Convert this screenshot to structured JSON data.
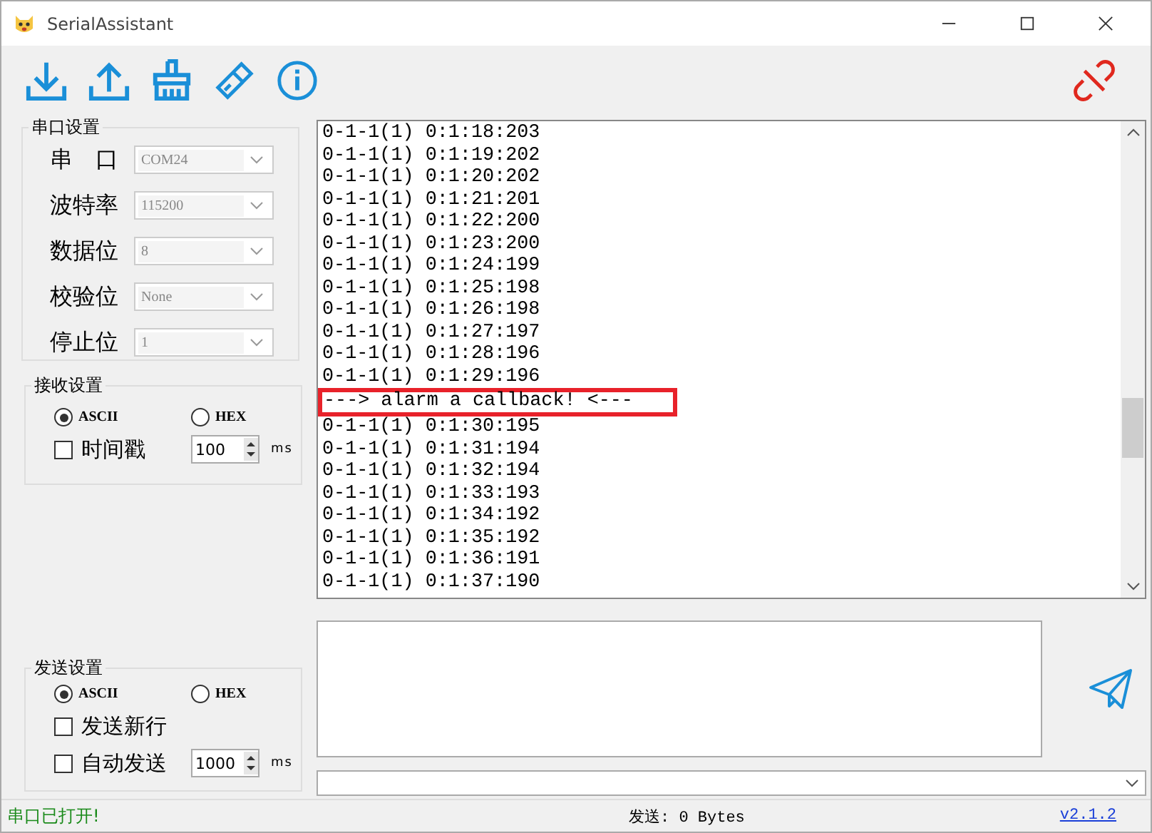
{
  "window": {
    "title": "SerialAssistant"
  },
  "serial_settings": {
    "title": "串口设置",
    "fields": [
      {
        "label": "串　口",
        "value": "COM24",
        "disabled": true
      },
      {
        "label": "波特率",
        "value": "115200",
        "disabled": true
      },
      {
        "label": "数据位",
        "value": "8",
        "disabled": true
      },
      {
        "label": "校验位",
        "value": "None",
        "disabled": true
      },
      {
        "label": "停止位",
        "value": "1",
        "disabled": true
      }
    ]
  },
  "receive_settings": {
    "title": "接收设置",
    "modes": [
      {
        "label": "ASCII",
        "selected": true
      },
      {
        "label": "HEX",
        "selected": false
      }
    ],
    "options": [
      {
        "label": "时间戳",
        "checked": false,
        "interval": "100",
        "unit": "ms"
      }
    ]
  },
  "send_settings": {
    "title": "发送设置",
    "modes": [
      {
        "label": "ASCII",
        "selected": true
      },
      {
        "label": "HEX",
        "selected": false
      }
    ],
    "options": [
      {
        "label": "发送新行",
        "checked": false
      },
      {
        "label": "自动发送",
        "checked": false,
        "interval": "1000",
        "unit": "ms"
      }
    ]
  },
  "log": {
    "lines": [
      {
        "text": "0-1-1(1) 0:1:18:203",
        "highlighted": false
      },
      {
        "text": "0-1-1(1) 0:1:19:202",
        "highlighted": false
      },
      {
        "text": "0-1-1(1) 0:1:20:202",
        "highlighted": false
      },
      {
        "text": "0-1-1(1) 0:1:21:201",
        "highlighted": false
      },
      {
        "text": "0-1-1(1) 0:1:22:200",
        "highlighted": false
      },
      {
        "text": "0-1-1(1) 0:1:23:200",
        "highlighted": false
      },
      {
        "text": "0-1-1(1) 0:1:24:199",
        "highlighted": false
      },
      {
        "text": "0-1-1(1) 0:1:25:198",
        "highlighted": false
      },
      {
        "text": "0-1-1(1) 0:1:26:198",
        "highlighted": false
      },
      {
        "text": "0-1-1(1) 0:1:27:197",
        "highlighted": false
      },
      {
        "text": "0-1-1(1) 0:1:28:196",
        "highlighted": false
      },
      {
        "text": "0-1-1(1) 0:1:29:196",
        "highlighted": false
      },
      {
        "text": "---> alarm a callback! <---",
        "highlighted": true
      },
      {
        "text": "0-1-1(1) 0:1:30:195",
        "highlighted": false
      },
      {
        "text": "0-1-1(1) 0:1:31:194",
        "highlighted": false
      },
      {
        "text": "0-1-1(1) 0:1:32:194",
        "highlighted": false
      },
      {
        "text": "0-1-1(1) 0:1:33:193",
        "highlighted": false
      },
      {
        "text": "0-1-1(1) 0:1:34:192",
        "highlighted": false
      },
      {
        "text": "0-1-1(1) 0:1:35:192",
        "highlighted": false
      },
      {
        "text": "0-1-1(1) 0:1:36:191",
        "highlighted": false
      },
      {
        "text": "0-1-1(1) 0:1:37:190",
        "highlighted": false
      }
    ]
  },
  "status_bar": {
    "message": "串口已打开!",
    "sent": "发送: 0 Bytes",
    "version": "v2.1.2"
  }
}
